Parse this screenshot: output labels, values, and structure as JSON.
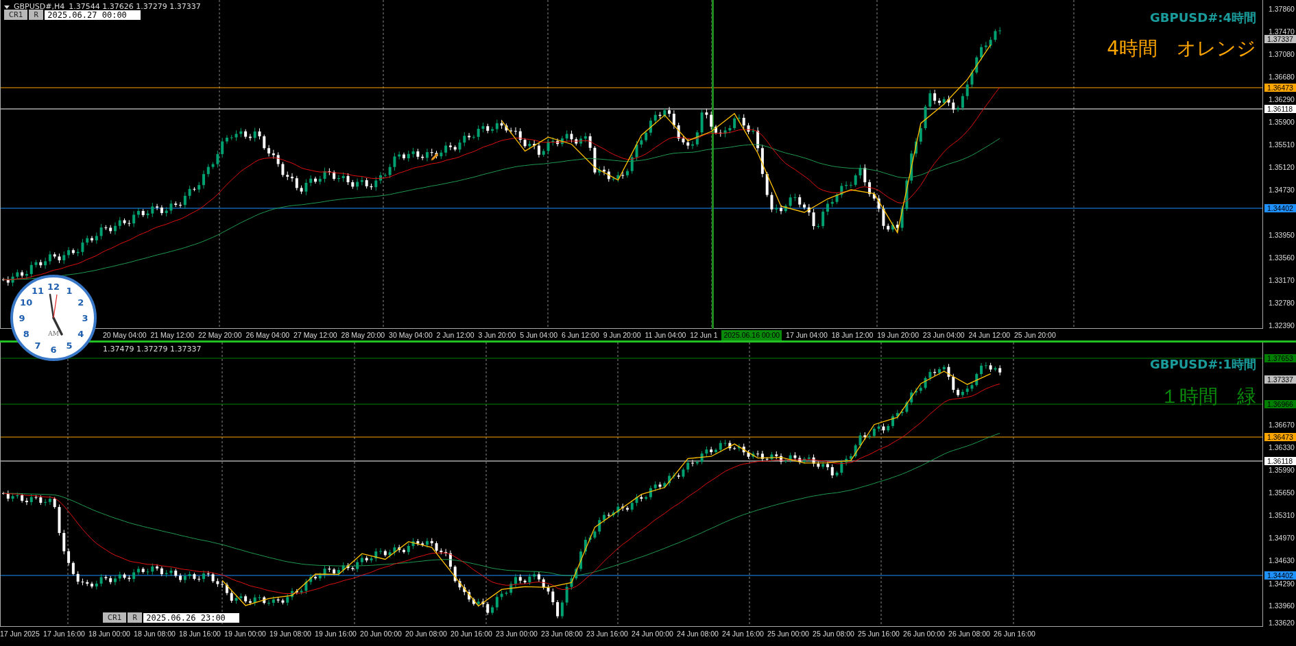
{
  "panels": [
    {
      "header": {
        "symbol": "GBPUSD#,H4",
        "ohlc": "1.37544 1.37626 1.37279 1.37337"
      },
      "buttons": [
        "CR1",
        "R"
      ],
      "date_field": "2025.06.27 00:00",
      "title": "GBPUSD#:4時間",
      "note": "4時間　オレンジ",
      "axis_ticks": [
        "1.37860",
        "1.37470",
        "1.37080",
        "1.36680",
        "1.36290",
        "1.35900",
        "1.35510",
        "1.35120",
        "1.34730",
        "1.33950",
        "1.33560",
        "1.33170",
        "1.32780",
        "1.32390"
      ],
      "price_tags": [
        {
          "text": "1.37337",
          "kind": "price",
          "color": "#c0c0c0"
        },
        {
          "text": "1.36473",
          "kind": "line",
          "color": "#ffa500"
        },
        {
          "text": "1.36118",
          "kind": "line",
          "color": "#ffffff"
        },
        {
          "text": "1.34402",
          "kind": "line",
          "color": "#1e90ff"
        }
      ],
      "time_labels": [
        {
          "text": "20 May 04:00",
          "kind": "label"
        },
        {
          "text": "21 May 12:00",
          "kind": "label"
        },
        {
          "text": "22 May 20:00",
          "kind": "label"
        },
        {
          "text": "26 May 04:00",
          "kind": "label"
        },
        {
          "text": "27 May 12:00",
          "kind": "label"
        },
        {
          "text": "28 May 20:00",
          "kind": "label"
        },
        {
          "text": "30 May 04:00",
          "kind": "label"
        },
        {
          "text": "2 Jun 12:00",
          "kind": "label"
        },
        {
          "text": "3 Jun 20:00",
          "kind": "label"
        },
        {
          "text": "5 Jun 04:00",
          "kind": "label"
        },
        {
          "text": "6 Jun 12:00",
          "kind": "label"
        },
        {
          "text": "9 Jun 20:00",
          "kind": "label"
        },
        {
          "text": "11 Jun 04:00",
          "kind": "label"
        },
        {
          "text": "12 Jun 1",
          "kind": "label"
        },
        {
          "text": "2025.06.16 00:00",
          "kind": "crosshair"
        },
        {
          "text": "17 Jun 04:00",
          "kind": "label"
        },
        {
          "text": "18 Jun 12:00",
          "kind": "label"
        },
        {
          "text": "19 Jun 20:00",
          "kind": "label"
        },
        {
          "text": "23 Jun 04:00",
          "kind": "label"
        },
        {
          "text": "24 Jun 12:00",
          "kind": "label"
        },
        {
          "text": "25 Jun 20:00",
          "kind": "label"
        }
      ]
    },
    {
      "header": {
        "ohlc": "1.37479 1.37279 1.37337"
      },
      "buttons": [
        "CR1",
        "R"
      ],
      "date_field": "2025.06.26 23:00",
      "title": "GBPUSD#:1時間",
      "note": "１時間　緑",
      "axis_ticks": [
        "1.36670",
        "1.36330",
        "1.35990",
        "1.35650",
        "1.35310",
        "1.34970",
        "1.34630",
        "1.34290",
        "1.33960",
        "1.33620"
      ],
      "price_tags": [
        {
          "text": "1.37653",
          "kind": "line",
          "color": "#008000"
        },
        {
          "text": "1.37337",
          "kind": "price",
          "color": "#c0c0c0"
        },
        {
          "text": "1.36966",
          "kind": "line",
          "color": "#008000"
        },
        {
          "text": "1.36473",
          "kind": "line",
          "color": "#ffa500"
        },
        {
          "text": "1.36118",
          "kind": "line",
          "color": "#ffffff"
        },
        {
          "text": "1.34402",
          "kind": "line",
          "color": "#1e90ff"
        }
      ],
      "time_labels": [
        {
          "text": "17 Jun 2025",
          "kind": "label"
        },
        {
          "text": "17 Jun 16:00",
          "kind": "label"
        },
        {
          "text": "18 Jun 00:00",
          "kind": "label"
        },
        {
          "text": "18 Jun 08:00",
          "kind": "label"
        },
        {
          "text": "18 Jun 16:00",
          "kind": "label"
        },
        {
          "text": "19 Jun 00:00",
          "kind": "label"
        },
        {
          "text": "19 Jun 08:00",
          "kind": "label"
        },
        {
          "text": "19 Jun 16:00",
          "kind": "label"
        },
        {
          "text": "20 Jun 00:00",
          "kind": "label"
        },
        {
          "text": "20 Jun 08:00",
          "kind": "label"
        },
        {
          "text": "20 Jun 16:00",
          "kind": "label"
        },
        {
          "text": "23 Jun 00:00",
          "kind": "label"
        },
        {
          "text": "23 Jun 08:00",
          "kind": "label"
        },
        {
          "text": "23 Jun 16:00",
          "kind": "label"
        },
        {
          "text": "24 Jun 00:00",
          "kind": "label"
        },
        {
          "text": "24 Jun 08:00",
          "kind": "label"
        },
        {
          "text": "24 Jun 16:00",
          "kind": "label"
        },
        {
          "text": "25 Jun 00:00",
          "kind": "label"
        },
        {
          "text": "25 Jun 08:00",
          "kind": "label"
        },
        {
          "text": "25 Jun 16:00",
          "kind": "label"
        },
        {
          "text": "26 Jun 00:00",
          "kind": "label"
        },
        {
          "text": "26 Jun 08:00",
          "kind": "label"
        },
        {
          "text": "26 Jun 16:00",
          "kind": "label"
        }
      ]
    }
  ],
  "clock": {
    "numerals": [
      "12",
      "11",
      "1",
      "10",
      "2",
      "9",
      "3",
      "8",
      "4",
      "7",
      "5",
      "6"
    ],
    "period": "AM"
  }
}
